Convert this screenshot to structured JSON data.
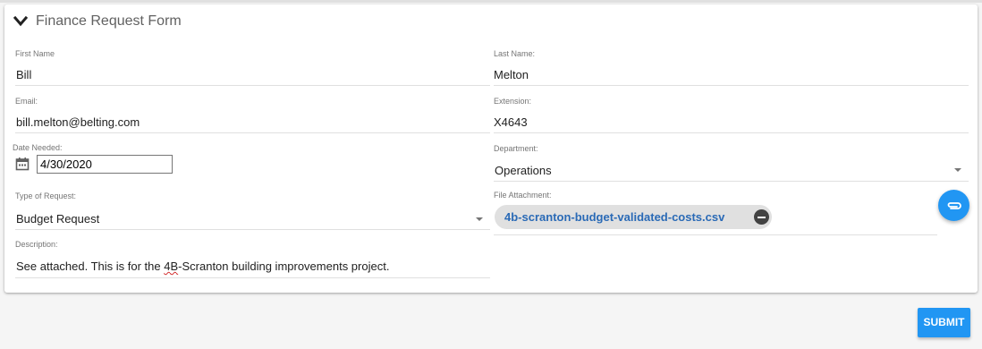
{
  "form": {
    "title": "Finance Request Form",
    "fields": {
      "first_name": {
        "label": "First Name",
        "value": "Bill"
      },
      "last_name": {
        "label": "Last Name:",
        "value": "Melton"
      },
      "email": {
        "label": "Email:",
        "value": "bill.melton@belting.com"
      },
      "extension": {
        "label": "Extension:",
        "value": "X4643"
      },
      "date_needed": {
        "label": "Date Needed:",
        "value": "4/30/2020"
      },
      "department": {
        "label": "Department:",
        "value": "Operations"
      },
      "request_type": {
        "label": "Type of Request:",
        "value": "Budget Request"
      },
      "file_attachment": {
        "label": "File Attachment:",
        "file_name": "4b-scranton-budget-validated-costs.csv"
      },
      "description": {
        "label": "Description:",
        "value_before": "See attached. This is for the ",
        "value_misspelled": "4B",
        "value_after": "-Scranton building improvements project."
      }
    }
  },
  "actions": {
    "submit_label": "SUBMIT"
  },
  "icons": {
    "collapse": "chevron-down-icon",
    "calendar": "calendar-icon",
    "dropdown": "dropdown-arrow-icon",
    "remove": "remove-circle-icon",
    "attach": "paperclip-icon"
  },
  "colors": {
    "accent": "#2196f3",
    "chip_text": "#2a6ab6",
    "chip_bg": "#e0e0e0"
  }
}
